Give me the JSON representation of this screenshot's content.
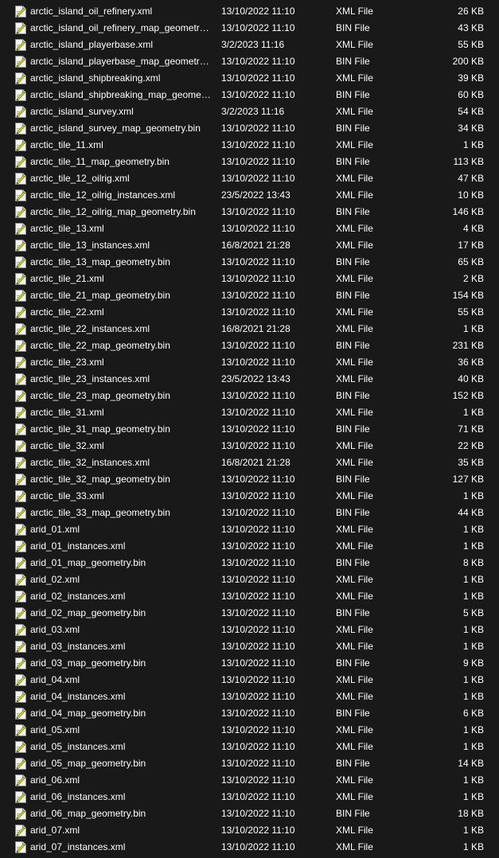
{
  "colors": {
    "background": "#191919",
    "text": "#ffffff"
  },
  "files": [
    {
      "name": "arctic_island_oil_refinery.xml",
      "date": "13/10/2022 11:10",
      "type": "XML File",
      "size": "26 KB",
      "icon": "xml-file-icon"
    },
    {
      "name": "arctic_island_oil_refinery_map_geometry....",
      "date": "13/10/2022 11:10",
      "type": "BIN File",
      "size": "43 KB",
      "icon": "bin-file-icon"
    },
    {
      "name": "arctic_island_playerbase.xml",
      "date": "3/2/2023 11:16",
      "type": "XML File",
      "size": "55 KB",
      "icon": "xml-file-icon"
    },
    {
      "name": "arctic_island_playerbase_map_geometry....",
      "date": "13/10/2022 11:10",
      "type": "BIN File",
      "size": "200 KB",
      "icon": "bin-file-icon"
    },
    {
      "name": "arctic_island_shipbreaking.xml",
      "date": "13/10/2022 11:10",
      "type": "XML File",
      "size": "39 KB",
      "icon": "xml-file-icon"
    },
    {
      "name": "arctic_island_shipbreaking_map_geometr...",
      "date": "13/10/2022 11:10",
      "type": "BIN File",
      "size": "60 KB",
      "icon": "bin-file-icon"
    },
    {
      "name": "arctic_island_survey.xml",
      "date": "3/2/2023 11:16",
      "type": "XML File",
      "size": "54 KB",
      "icon": "xml-file-icon"
    },
    {
      "name": "arctic_island_survey_map_geometry.bin",
      "date": "13/10/2022 11:10",
      "type": "BIN File",
      "size": "34 KB",
      "icon": "bin-file-icon"
    },
    {
      "name": "arctic_tile_11.xml",
      "date": "13/10/2022 11:10",
      "type": "XML File",
      "size": "1 KB",
      "icon": "xml-file-icon"
    },
    {
      "name": "arctic_tile_11_map_geometry.bin",
      "date": "13/10/2022 11:10",
      "type": "BIN File",
      "size": "113 KB",
      "icon": "bin-file-icon"
    },
    {
      "name": "arctic_tile_12_oilrig.xml",
      "date": "13/10/2022 11:10",
      "type": "XML File",
      "size": "47 KB",
      "icon": "xml-file-icon"
    },
    {
      "name": "arctic_tile_12_oilrig_instances.xml",
      "date": "23/5/2022 13:43",
      "type": "XML File",
      "size": "10 KB",
      "icon": "xml-file-icon"
    },
    {
      "name": "arctic_tile_12_oilrig_map_geometry.bin",
      "date": "13/10/2022 11:10",
      "type": "BIN File",
      "size": "146 KB",
      "icon": "bin-file-icon"
    },
    {
      "name": "arctic_tile_13.xml",
      "date": "13/10/2022 11:10",
      "type": "XML File",
      "size": "4 KB",
      "icon": "xml-file-icon"
    },
    {
      "name": "arctic_tile_13_instances.xml",
      "date": "16/8/2021 21:28",
      "type": "XML File",
      "size": "17 KB",
      "icon": "xml-file-icon"
    },
    {
      "name": "arctic_tile_13_map_geometry.bin",
      "date": "13/10/2022 11:10",
      "type": "BIN File",
      "size": "65 KB",
      "icon": "bin-file-icon"
    },
    {
      "name": "arctic_tile_21.xml",
      "date": "13/10/2022 11:10",
      "type": "XML File",
      "size": "2 KB",
      "icon": "xml-file-icon"
    },
    {
      "name": "arctic_tile_21_map_geometry.bin",
      "date": "13/10/2022 11:10",
      "type": "BIN File",
      "size": "154 KB",
      "icon": "bin-file-icon"
    },
    {
      "name": "arctic_tile_22.xml",
      "date": "13/10/2022 11:10",
      "type": "XML File",
      "size": "55 KB",
      "icon": "xml-file-icon"
    },
    {
      "name": "arctic_tile_22_instances.xml",
      "date": "16/8/2021 21:28",
      "type": "XML File",
      "size": "1 KB",
      "icon": "xml-file-icon"
    },
    {
      "name": "arctic_tile_22_map_geometry.bin",
      "date": "13/10/2022 11:10",
      "type": "BIN File",
      "size": "231 KB",
      "icon": "bin-file-icon"
    },
    {
      "name": "arctic_tile_23.xml",
      "date": "13/10/2022 11:10",
      "type": "XML File",
      "size": "36 KB",
      "icon": "xml-file-icon"
    },
    {
      "name": "arctic_tile_23_instances.xml",
      "date": "23/5/2022 13:43",
      "type": "XML File",
      "size": "40 KB",
      "icon": "xml-file-icon"
    },
    {
      "name": "arctic_tile_23_map_geometry.bin",
      "date": "13/10/2022 11:10",
      "type": "BIN File",
      "size": "152 KB",
      "icon": "bin-file-icon"
    },
    {
      "name": "arctic_tile_31.xml",
      "date": "13/10/2022 11:10",
      "type": "XML File",
      "size": "1 KB",
      "icon": "xml-file-icon"
    },
    {
      "name": "arctic_tile_31_map_geometry.bin",
      "date": "13/10/2022 11:10",
      "type": "BIN File",
      "size": "71 KB",
      "icon": "bin-file-icon"
    },
    {
      "name": "arctic_tile_32.xml",
      "date": "13/10/2022 11:10",
      "type": "XML File",
      "size": "22 KB",
      "icon": "xml-file-icon"
    },
    {
      "name": "arctic_tile_32_instances.xml",
      "date": "16/8/2021 21:28",
      "type": "XML File",
      "size": "35 KB",
      "icon": "xml-file-icon"
    },
    {
      "name": "arctic_tile_32_map_geometry.bin",
      "date": "13/10/2022 11:10",
      "type": "BIN File",
      "size": "127 KB",
      "icon": "bin-file-icon"
    },
    {
      "name": "arctic_tile_33.xml",
      "date": "13/10/2022 11:10",
      "type": "XML File",
      "size": "1 KB",
      "icon": "xml-file-icon"
    },
    {
      "name": "arctic_tile_33_map_geometry.bin",
      "date": "13/10/2022 11:10",
      "type": "BIN File",
      "size": "44 KB",
      "icon": "bin-file-icon"
    },
    {
      "name": "arid_01.xml",
      "date": "13/10/2022 11:10",
      "type": "XML File",
      "size": "1 KB",
      "icon": "xml-file-icon"
    },
    {
      "name": "arid_01_instances.xml",
      "date": "13/10/2022 11:10",
      "type": "XML File",
      "size": "1 KB",
      "icon": "xml-file-icon"
    },
    {
      "name": "arid_01_map_geometry.bin",
      "date": "13/10/2022 11:10",
      "type": "BIN File",
      "size": "8 KB",
      "icon": "bin-file-icon"
    },
    {
      "name": "arid_02.xml",
      "date": "13/10/2022 11:10",
      "type": "XML File",
      "size": "1 KB",
      "icon": "xml-file-icon"
    },
    {
      "name": "arid_02_instances.xml",
      "date": "13/10/2022 11:10",
      "type": "XML File",
      "size": "1 KB",
      "icon": "xml-file-icon"
    },
    {
      "name": "arid_02_map_geometry.bin",
      "date": "13/10/2022 11:10",
      "type": "BIN File",
      "size": "5 KB",
      "icon": "bin-file-icon"
    },
    {
      "name": "arid_03.xml",
      "date": "13/10/2022 11:10",
      "type": "XML File",
      "size": "1 KB",
      "icon": "xml-file-icon"
    },
    {
      "name": "arid_03_instances.xml",
      "date": "13/10/2022 11:10",
      "type": "XML File",
      "size": "1 KB",
      "icon": "xml-file-icon"
    },
    {
      "name": "arid_03_map_geometry.bin",
      "date": "13/10/2022 11:10",
      "type": "BIN File",
      "size": "9 KB",
      "icon": "bin-file-icon"
    },
    {
      "name": "arid_04.xml",
      "date": "13/10/2022 11:10",
      "type": "XML File",
      "size": "1 KB",
      "icon": "xml-file-icon"
    },
    {
      "name": "arid_04_instances.xml",
      "date": "13/10/2022 11:10",
      "type": "XML File",
      "size": "1 KB",
      "icon": "xml-file-icon"
    },
    {
      "name": "arid_04_map_geometry.bin",
      "date": "13/10/2022 11:10",
      "type": "BIN File",
      "size": "6 KB",
      "icon": "bin-file-icon"
    },
    {
      "name": "arid_05.xml",
      "date": "13/10/2022 11:10",
      "type": "XML File",
      "size": "1 KB",
      "icon": "xml-file-icon"
    },
    {
      "name": "arid_05_instances.xml",
      "date": "13/10/2022 11:10",
      "type": "XML File",
      "size": "1 KB",
      "icon": "xml-file-icon"
    },
    {
      "name": "arid_05_map_geometry.bin",
      "date": "13/10/2022 11:10",
      "type": "BIN File",
      "size": "14 KB",
      "icon": "bin-file-icon"
    },
    {
      "name": "arid_06.xml",
      "date": "13/10/2022 11:10",
      "type": "XML File",
      "size": "1 KB",
      "icon": "xml-file-icon"
    },
    {
      "name": "arid_06_instances.xml",
      "date": "13/10/2022 11:10",
      "type": "XML File",
      "size": "1 KB",
      "icon": "xml-file-icon"
    },
    {
      "name": "arid_06_map_geometry.bin",
      "date": "13/10/2022 11:10",
      "type": "BIN File",
      "size": "18 KB",
      "icon": "bin-file-icon"
    },
    {
      "name": "arid_07.xml",
      "date": "13/10/2022 11:10",
      "type": "XML File",
      "size": "1 KB",
      "icon": "xml-file-icon"
    },
    {
      "name": "arid_07_instances.xml",
      "date": "13/10/2022 11:10",
      "type": "XML File",
      "size": "1 KB",
      "icon": "xml-file-icon"
    }
  ]
}
